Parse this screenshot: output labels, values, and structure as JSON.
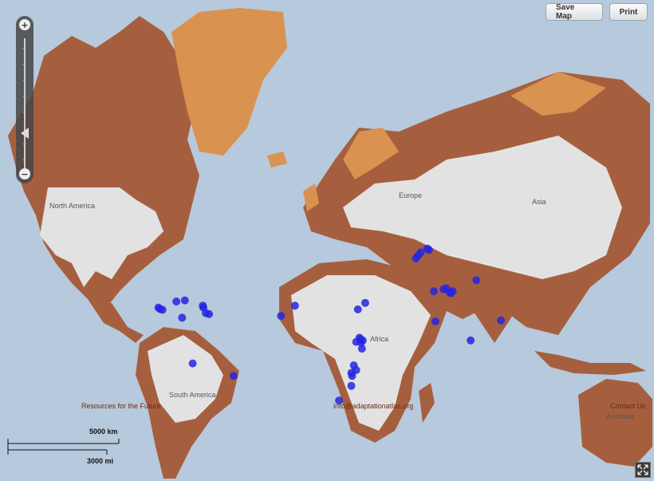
{
  "toolbar": {
    "save_label": "Save Map",
    "print_label": "Print"
  },
  "zoom": {
    "in_icon": "plus-icon",
    "out_icon": "minus-icon"
  },
  "labels": {
    "north_america": "North America",
    "south_america": "South America",
    "europe": "Europe",
    "asia": "Asia",
    "africa": "Africa",
    "australia": "Australia"
  },
  "footer": {
    "left": "Resources for the Future",
    "center": "info@adaptationatlas.org",
    "right": "Contact Us"
  },
  "scale": {
    "km": "5000 km",
    "mi": "3000 mi"
  },
  "colors": {
    "ocean": "#b7c9dc",
    "land_light": "#e2e2e2",
    "land_mid": "#d9924f",
    "land_dark": "#a65f3e",
    "point": "#2626e0"
  },
  "project_points": [
    {
      "lon": -88.5,
      "lat": 15.0
    },
    {
      "lon": -87.5,
      "lat": 14.2
    },
    {
      "lon": -86.0,
      "lat": 13.8
    },
    {
      "lon": -77.5,
      "lat": 18.2
    },
    {
      "lon": -72.3,
      "lat": 18.8
    },
    {
      "lon": -61.3,
      "lat": 16.0
    },
    {
      "lon": -61.0,
      "lat": 15.0
    },
    {
      "lon": -59.5,
      "lat": 12.0
    },
    {
      "lon": -57.5,
      "lat": 11.5
    },
    {
      "lon": -74.0,
      "lat": 9.5
    },
    {
      "lon": -67.5,
      "lat": -15.5
    },
    {
      "lon": -42.5,
      "lat": -22.0
    },
    {
      "lon": -13.5,
      "lat": 10.5
    },
    {
      "lon": -5.0,
      "lat": 16.0
    },
    {
      "lon": 22.0,
      "lat": -34.0
    },
    {
      "lon": 33.5,
      "lat": 14.0
    },
    {
      "lon": 38.0,
      "lat": 17.5
    },
    {
      "lon": 34.5,
      "lat": -1.5
    },
    {
      "lon": 35.0,
      "lat": -2.5
    },
    {
      "lon": 36.5,
      "lat": -3.0
    },
    {
      "lon": 35.5,
      "lat": -4.2
    },
    {
      "lon": 32.5,
      "lat": -3.8
    },
    {
      "lon": 36.0,
      "lat": -7.5
    },
    {
      "lon": 31.0,
      "lat": -16.5
    },
    {
      "lon": 32.5,
      "lat": -19.0
    },
    {
      "lon": 29.5,
      "lat": -20.5
    },
    {
      "lon": 30.0,
      "lat": -22.0
    },
    {
      "lon": 29.5,
      "lat": -27.0
    },
    {
      "lon": 69.0,
      "lat": 39.0
    },
    {
      "lon": 70.5,
      "lat": 40.2
    },
    {
      "lon": 72.0,
      "lat": 41.5
    },
    {
      "lon": 76.0,
      "lat": 43.0
    },
    {
      "lon": 77.0,
      "lat": 42.5
    },
    {
      "lon": 80.0,
      "lat": 23.5
    },
    {
      "lon": 86.0,
      "lat": 24.5
    },
    {
      "lon": 87.5,
      "lat": 25.0
    },
    {
      "lon": 89.5,
      "lat": 23.0
    },
    {
      "lon": 90.5,
      "lat": 22.5
    },
    {
      "lon": 91.5,
      "lat": 23.5
    },
    {
      "lon": 81.0,
      "lat": 7.5
    },
    {
      "lon": 106.0,
      "lat": 29.0
    },
    {
      "lon": 121.0,
      "lat": 8.0
    },
    {
      "lon": 102.5,
      "lat": -3.0
    }
  ]
}
